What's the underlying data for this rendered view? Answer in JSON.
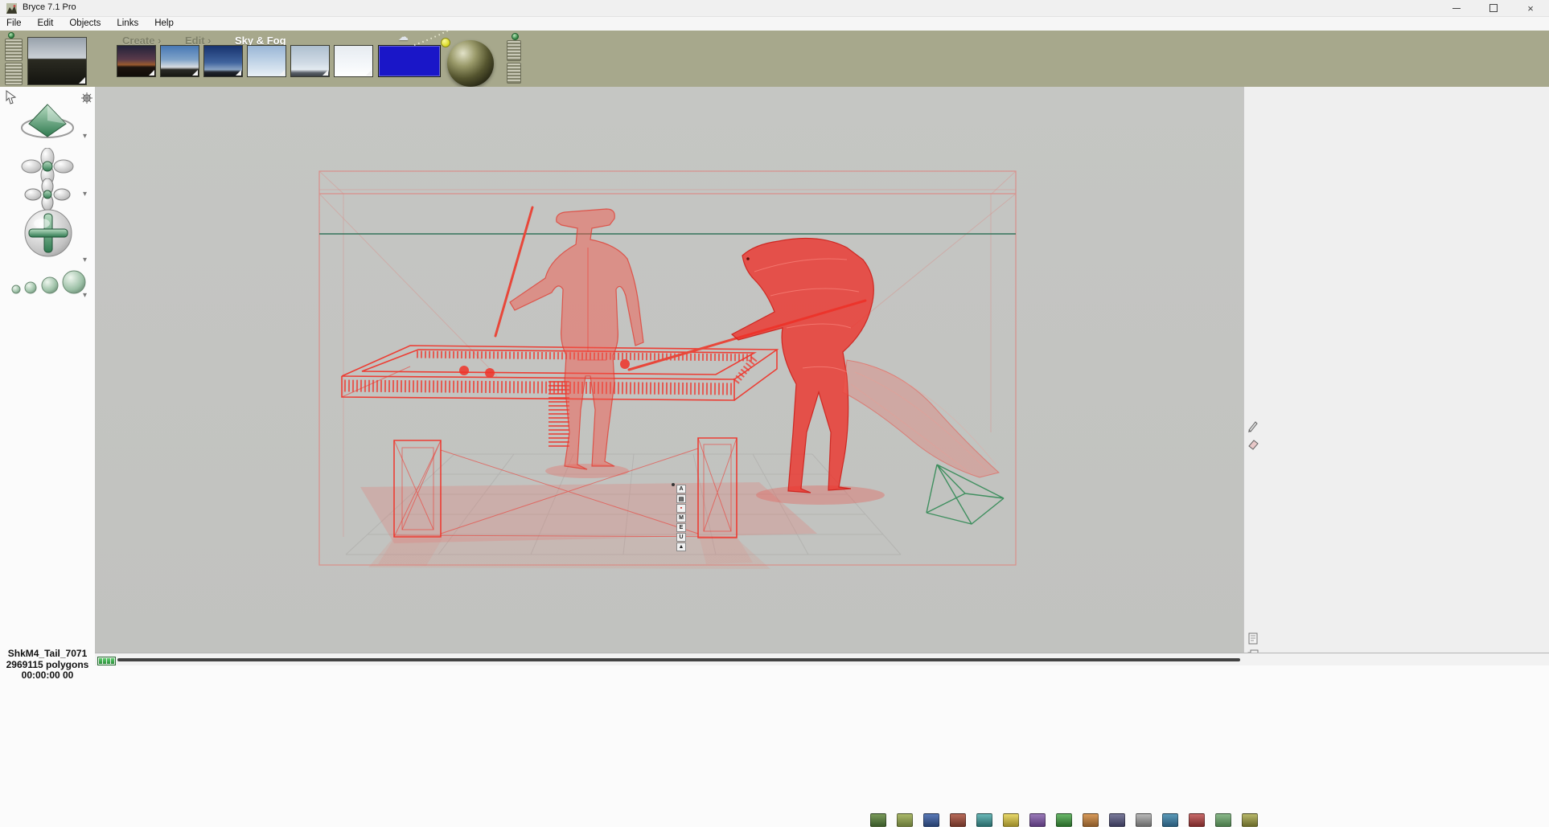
{
  "window": {
    "title": "Bryce 7.1 Pro",
    "close_glyph": "×"
  },
  "menu": {
    "items": [
      "File",
      "Edit",
      "Objects",
      "Links",
      "Help"
    ]
  },
  "toolbar": {
    "modes": [
      "Create ›",
      "Edit ›",
      "Sky & Fog"
    ],
    "active_mode": "Sky & Fog",
    "preset_names": [
      "sunset-mountains",
      "blue-sky-clouds",
      "deep-blue-sky",
      "pale-sky",
      "hazy-sky",
      "white-sky"
    ],
    "swatch_color": "#1a16c8"
  },
  "object_toolbar": {
    "buttons": [
      "A",
      "▤",
      "▪",
      "M",
      "E",
      "U",
      "▲"
    ]
  },
  "status": {
    "object_name": "ShkM4_Tail_7071",
    "polygons": "2969115 polygons",
    "render_time": "00:00:00 00"
  },
  "icons": {
    "chevron_down": "▾",
    "cloud": "☁",
    "menu_arrow": "›"
  },
  "colors": {
    "toolbar-olive": "#a7a88c",
    "viewport-gray": "#c5c6c3",
    "wire-red": "#f03228",
    "selection-pink": "#d98f8a",
    "horizon-green": "#33735a",
    "cone-green": "#3f8f5f",
    "swatch-blue": "#1a16c8"
  }
}
